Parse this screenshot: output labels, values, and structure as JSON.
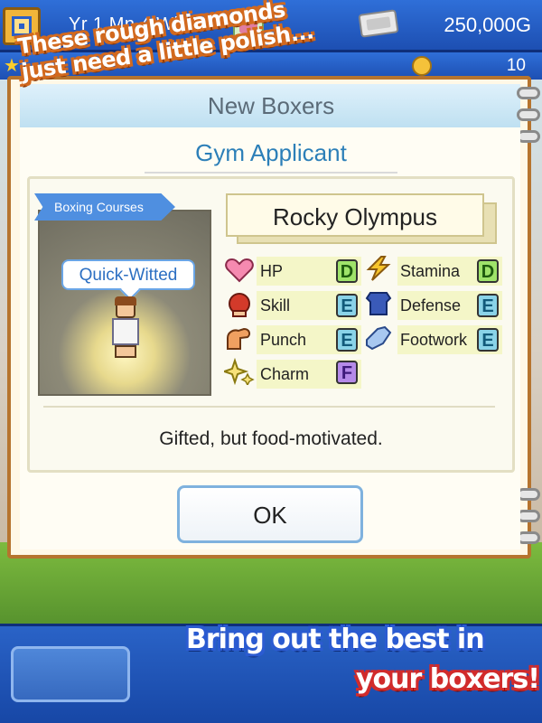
{
  "status_bar": {
    "date": "Yr  1 Mn  4 Wk 1",
    "money": "250,000G",
    "points": "10"
  },
  "window": {
    "title": "New Boxers",
    "subtitle": "Gym Applicant"
  },
  "boxer": {
    "course": "Boxing Courses",
    "trait": "Quick-Witted",
    "name": "Rocky Olympus",
    "description": "Gifted, but food-motivated."
  },
  "stats": [
    {
      "label": "HP",
      "grade": "D",
      "icon": "heart-icon"
    },
    {
      "label": "Stamina",
      "grade": "D",
      "icon": "lightning-icon"
    },
    {
      "label": "Skill",
      "grade": "E",
      "icon": "boxing-glove-icon"
    },
    {
      "label": "Defense",
      "grade": "E",
      "icon": "armor-icon"
    },
    {
      "label": "Punch",
      "grade": "E",
      "icon": "flexed-arm-icon"
    },
    {
      "label": "Footwork",
      "grade": "E",
      "icon": "shoe-icon"
    },
    {
      "label": "Charm",
      "grade": "F",
      "icon": "sparkle-icon"
    }
  ],
  "ok_label": "OK",
  "promo": {
    "top_line1": "These rough diamonds",
    "top_line2": "just need a little polish...",
    "bottom_line1": "Bring out the best in",
    "bottom_line2": "your boxers!"
  },
  "colors": {
    "grade_d": "#9fe36a",
    "grade_e": "#8ad3e8",
    "grade_f": "#b58ae8",
    "accent_blue": "#2c7fb8"
  }
}
